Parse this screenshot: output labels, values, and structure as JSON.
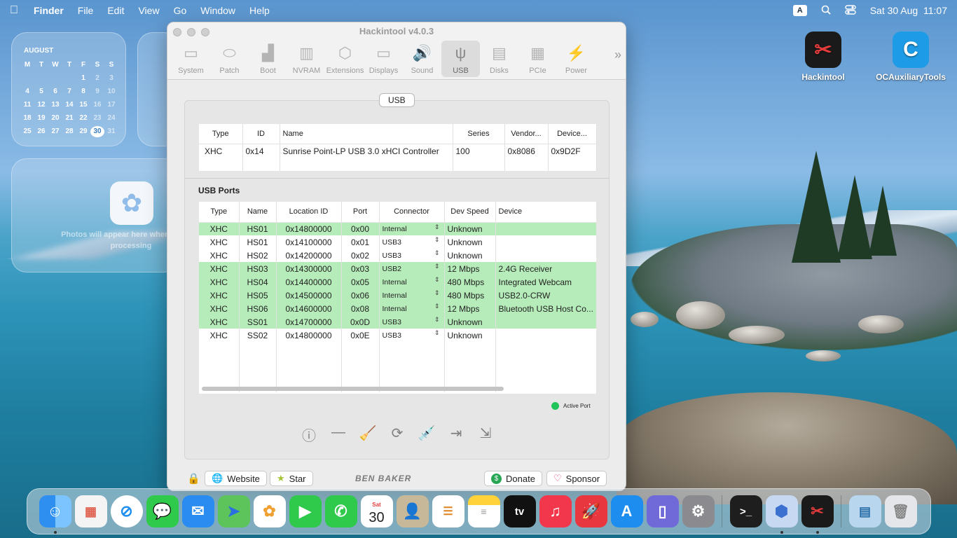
{
  "menubar": {
    "apple": "",
    "items": [
      "Finder",
      "File",
      "Edit",
      "View",
      "Go",
      "Window",
      "Help"
    ],
    "input_badge": "A",
    "datetime": "Sat 30 Aug  11:07"
  },
  "calendar": {
    "month": "AUGUST",
    "weekdays": [
      "M",
      "T",
      "W",
      "T",
      "F",
      "S",
      "S"
    ],
    "days": [
      "",
      "",
      "",
      "",
      "1",
      "2",
      "3",
      "4",
      "5",
      "6",
      "7",
      "8",
      "9",
      "10",
      "11",
      "12",
      "13",
      "14",
      "15",
      "16",
      "17",
      "18",
      "19",
      "20",
      "21",
      "22",
      "23",
      "24",
      "25",
      "26",
      "27",
      "28",
      "29",
      "30",
      "31"
    ],
    "today": "30"
  },
  "photos_widget": {
    "text": "Photos will appear here when finished processing"
  },
  "desktop_icons": [
    {
      "label": "Hackintool",
      "icon": "hackintool-icon"
    },
    {
      "label": "OCAuxiliaryTools",
      "icon": "ocat-icon"
    }
  ],
  "window": {
    "title": "Hackintool v4.0.3",
    "toolbar": [
      {
        "label": "System",
        "icon": "system-icon"
      },
      {
        "label": "Patch",
        "icon": "patch-icon"
      },
      {
        "label": "Boot",
        "icon": "boot-icon"
      },
      {
        "label": "NVRAM",
        "icon": "nvram-icon"
      },
      {
        "label": "Extensions",
        "icon": "extensions-icon"
      },
      {
        "label": "Displays",
        "icon": "displays-icon"
      },
      {
        "label": "Sound",
        "icon": "sound-icon"
      },
      {
        "label": "USB",
        "icon": "usb-icon"
      },
      {
        "label": "Disks",
        "icon": "disks-icon"
      },
      {
        "label": "PCIe",
        "icon": "pcie-icon"
      },
      {
        "label": "Power",
        "icon": "power-icon"
      }
    ],
    "active_tab": "USB",
    "more": "»",
    "panel_label": "USB",
    "controllers": {
      "columns": [
        "Type",
        "ID",
        "Name",
        "Series",
        "Vendor...",
        "Device..."
      ],
      "rows": [
        [
          "XHC",
          "0x14",
          "Sunrise Point-LP USB 3.0 xHCI Controller",
          "100",
          "0x8086",
          "0x9D2F"
        ]
      ]
    },
    "ports_title": "USB Ports",
    "ports": {
      "columns": [
        "Type",
        "Name",
        "Location ID",
        "Port",
        "Connector",
        "Dev Speed",
        "Device"
      ],
      "rows": [
        {
          "active": true,
          "cells": [
            "XHC",
            "HS01",
            "0x14800000",
            "0x00",
            "Internal",
            "Unknown",
            ""
          ]
        },
        {
          "active": false,
          "cells": [
            "XHC",
            "HS01",
            "0x14100000",
            "0x01",
            "USB3",
            "Unknown",
            ""
          ]
        },
        {
          "active": false,
          "cells": [
            "XHC",
            "HS02",
            "0x14200000",
            "0x02",
            "USB3",
            "Unknown",
            ""
          ]
        },
        {
          "active": true,
          "cells": [
            "XHC",
            "HS03",
            "0x14300000",
            "0x03",
            "USB2",
            "12 Mbps",
            "2.4G Receiver"
          ]
        },
        {
          "active": true,
          "cells": [
            "XHC",
            "HS04",
            "0x14400000",
            "0x05",
            "Internal",
            "480 Mbps",
            "Integrated Webcam"
          ]
        },
        {
          "active": true,
          "cells": [
            "XHC",
            "HS05",
            "0x14500000",
            "0x06",
            "Internal",
            "480 Mbps",
            "USB2.0-CRW"
          ]
        },
        {
          "active": true,
          "cells": [
            "XHC",
            "HS06",
            "0x14600000",
            "0x08",
            "Internal",
            "12 Mbps",
            "Bluetooth USB Host Co..."
          ]
        },
        {
          "active": true,
          "cells": [
            "XHC",
            "SS01",
            "0x14700000",
            "0x0D",
            "USB3",
            "Unknown",
            ""
          ]
        },
        {
          "active": false,
          "cells": [
            "XHC",
            "SS02",
            "0x14800000",
            "0x0E",
            "USB3",
            "Unknown",
            ""
          ]
        }
      ]
    },
    "legend": "Active Port",
    "active_color": "#b6ecb9",
    "buttons": {
      "website": "Website",
      "star": "Star",
      "donate": "Donate",
      "sponsor": "Sponsor"
    },
    "brand": "BEN BAKER"
  },
  "dock": {
    "calendar_day": "Sat",
    "calendar_date": "30",
    "apple_tv": "tv"
  }
}
